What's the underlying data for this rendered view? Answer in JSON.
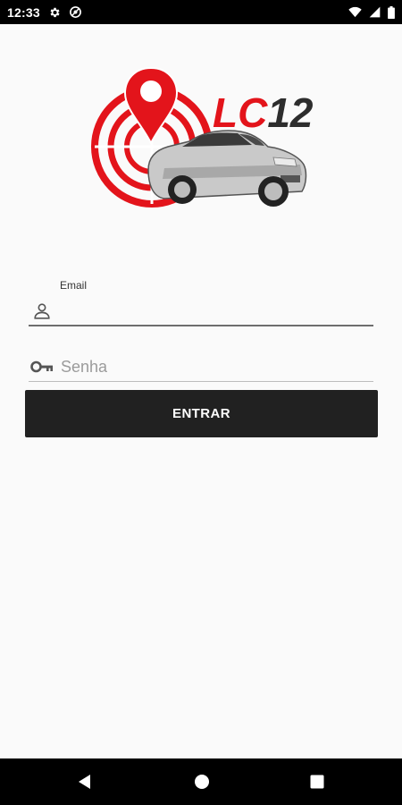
{
  "status_bar": {
    "time": "12:33",
    "left_icons": [
      "settings-icon",
      "app-notification-icon"
    ],
    "right_icons": [
      "wifi-icon",
      "cell-signal-icon",
      "battery-icon"
    ]
  },
  "logo": {
    "text": "LC12",
    "colors": {
      "red": "#e3141b",
      "dark": "#2d2d2d"
    }
  },
  "form": {
    "email": {
      "label": "Email",
      "value": "",
      "icon": "person-icon"
    },
    "password": {
      "placeholder": "Senha",
      "value": "",
      "icon": "key-icon"
    },
    "submit_label": "ENTRAR"
  },
  "nav_bar": {
    "buttons": [
      "back-icon",
      "home-icon",
      "recents-icon"
    ]
  },
  "colors": {
    "background": "#fafafa",
    "button": "#212121",
    "button_text": "#ffffff",
    "underline_active": "#6e6e6e",
    "underline_inactive": "#bdbdbd",
    "placeholder": "#9b9b9b"
  }
}
